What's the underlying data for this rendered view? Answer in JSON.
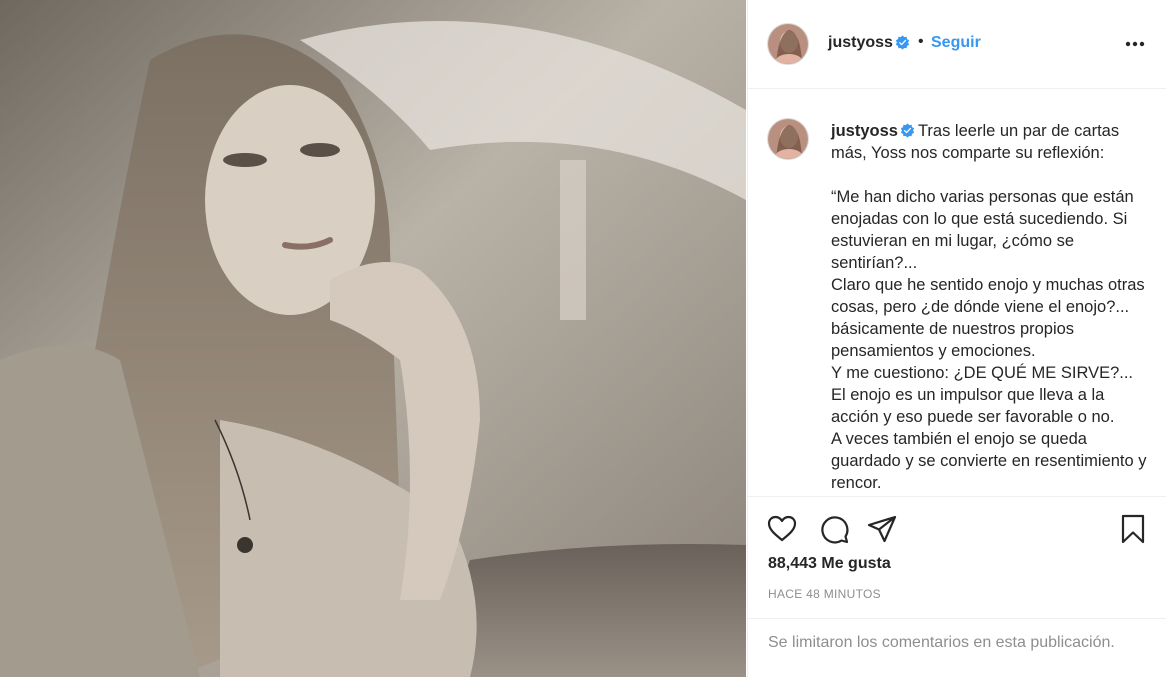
{
  "post": {
    "username": "justyoss",
    "separator": "•",
    "follow_label": "Seguir",
    "more_icon": "more-options-icon",
    "verified_icon": "verified-badge-icon",
    "caption": "Tras leerle un par de cartas más, Yoss nos comparte su reflexión:\n\n“Me han dicho varias personas que están enojadas con lo que está sucediendo. Si estuvieran en mi lugar, ¿cómo se sentirían?...\nClaro que he sentido enojo y muchas otras cosas, pero ¿de dónde viene el enojo?... básicamente de nuestros propios pensamientos y emociones.\nY me cuestiono: ¿DE QUÉ ME SIRVE?...\nEl enojo es un impulsor que lleva a la acción y eso puede ser favorable o no.\nA veces también el enojo se queda guardado y se convierte en resentimiento y rencor.",
    "likes": "88,443 Me gusta",
    "timestamp": "HACE 48 MINUTOS",
    "comments_limited": "Se limitaron los comentarios en esta publicación."
  },
  "icons": {
    "like": "heart-icon",
    "comment": "comment-icon",
    "share": "share-icon",
    "save": "bookmark-icon"
  },
  "colors": {
    "accent": "#3897f0",
    "text": "#262626",
    "muted": "#8e8e8e",
    "border": "#efefef"
  }
}
